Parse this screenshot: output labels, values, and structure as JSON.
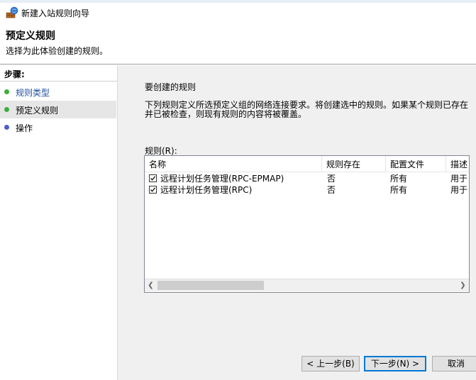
{
  "window": {
    "title": "新建入站规则向导",
    "icon": "firewall-wizard-icon"
  },
  "header": {
    "title": "预定义规则",
    "subtitle": "选择为此体验创建的规则。"
  },
  "steps": {
    "label": "步骤:",
    "items": [
      {
        "label": "规则类型",
        "state": "completed-link",
        "dot_color": "#3cae3c"
      },
      {
        "label": "预定义规则",
        "state": "current",
        "dot_color": "#3cae3c"
      },
      {
        "label": "操作",
        "state": "pending",
        "dot_color": "#4a5fc8"
      }
    ]
  },
  "main": {
    "heading": "要创建的规则",
    "description": "下列规则定义所选预定义组的网络连接要求。将创建选中的规则。如果某个规则已存在并已被检查，则现有规则的内容将被覆盖。",
    "rules_label": "规则(R):",
    "table": {
      "columns": [
        "名称",
        "规则存在",
        "配置文件",
        "描述"
      ],
      "rows": [
        {
          "checked": true,
          "name": "远程计划任务管理(RPC-EPMAP)",
          "exists": "否",
          "profile": "所有",
          "desc": "用于"
        },
        {
          "checked": true,
          "name": "远程计划任务管理(RPC)",
          "exists": "否",
          "profile": "所有",
          "desc": "用于"
        }
      ]
    }
  },
  "buttons": {
    "back": "< 上一步(B)",
    "next": "下一步(N) >",
    "cancel": "取消"
  }
}
